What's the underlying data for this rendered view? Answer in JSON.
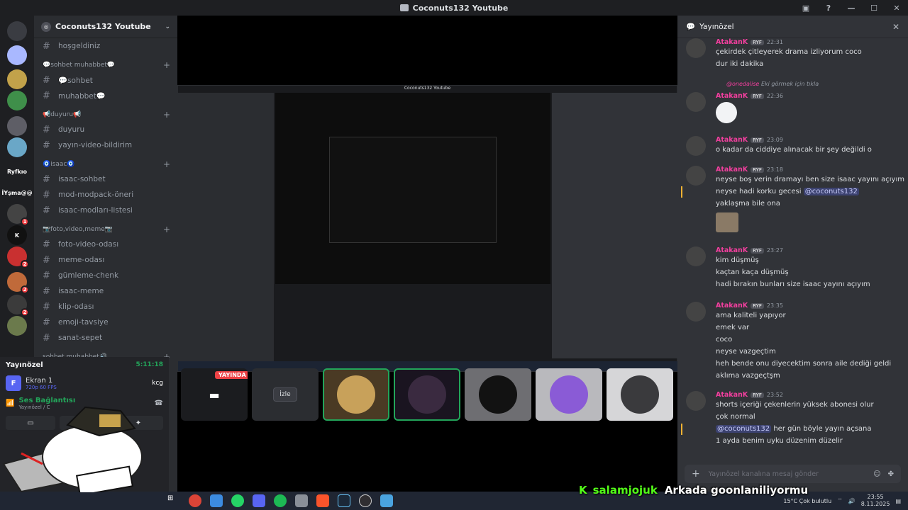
{
  "window": {
    "title": "Coconuts132 Youtube"
  },
  "rail": {
    "servers": [
      {
        "label": "",
        "color": "#3a3c42",
        "badge": ""
      },
      {
        "label": "",
        "color": "#a9b8ff",
        "badge": ""
      },
      {
        "label": "",
        "color": "#c2a24a",
        "badge": ""
      },
      {
        "label": "",
        "color": "#3f8f4a",
        "badge": ""
      },
      {
        "label": "",
        "color": "#5e5e66",
        "badge": ""
      },
      {
        "label": "",
        "color": "#6aa7c7",
        "badge": ""
      },
      {
        "label": "Ryfkıo",
        "color": "#1e1f22",
        "badge": ""
      },
      {
        "label": "İYşma@@",
        "color": "#1e1f22",
        "badge": ""
      },
      {
        "label": "",
        "color": "#444",
        "badge": "1"
      },
      {
        "label": "K",
        "color": "#111",
        "badge": ""
      },
      {
        "label": "",
        "color": "#c93030",
        "badge": "2"
      },
      {
        "label": "",
        "color": "#c06a3a",
        "badge": "2"
      },
      {
        "label": "",
        "color": "#3b3b3b",
        "badge": "2"
      },
      {
        "label": "",
        "color": "#6b7a4c",
        "badge": ""
      }
    ]
  },
  "sidebar": {
    "server_name": "Coconuts132 Youtube",
    "top_channel": "hoşgeldiniz",
    "categories": [
      {
        "name": "💬sohbet muhabbet💬",
        "channels": [
          "💬sohbet",
          "muhabbet💬"
        ]
      },
      {
        "name": "📢duyuru📢",
        "channels": [
          "duyuru",
          "yayın-video-bildirim"
        ]
      },
      {
        "name": "🧿isaac🧿",
        "channels": [
          "isaac-sohbet",
          "mod-modpack-öneri",
          "isaac-modları-listesi"
        ]
      },
      {
        "name": "📷foto,video,meme📷",
        "channels": [
          "foto-video-odası",
          "meme-odası",
          "gümleme-chenk",
          "isaac-meme",
          "klip-odası",
          "emoji-tavsiye",
          "sanat-sepet"
        ]
      },
      {
        "name": "sohbet muhabbet🔊",
        "channels": []
      }
    ]
  },
  "voice_panel": {
    "header": "Yayınözel",
    "time": "5:11:18",
    "stream_name": "Ekran 1",
    "stream_quality": "720p 60 FPS",
    "connection": "Ses Bağlantısı",
    "channel_path": "Yayınözel / C",
    "overlay_label": "kcg"
  },
  "stream": {
    "live_badge": "YAYINDA",
    "watch_label": "İzle",
    "nested_title": "Coconuts132 Youtube"
  },
  "chat": {
    "header": "Yayınözel",
    "input_placeholder": "Yayınözel kanalına mesaj gönder",
    "messages": [
      {
        "user": "AtakanK",
        "tag": "RYF",
        "time": "22:31",
        "lines": [
          "çekirdek çitleyerek drama izliyorum coco",
          "dur iki dakika"
        ]
      },
      {
        "reply_user": "@onedalise",
        "reply_text": "Eki görmek için tıkla",
        "user": "AtakanK",
        "tag": "RYF",
        "time": "22:36"
      },
      {
        "user": "AtakanK",
        "tag": "RYF",
        "time": "23:09",
        "lines": [
          "o kadar da ciddiye alınacak bir şey değildi o"
        ]
      },
      {
        "user": "AtakanK",
        "tag": "RYF",
        "time": "23:18",
        "lines": [
          "neyse boş verin dramayı ben size isaac yayını açıyım",
          "neyse hadi korku gecesi",
          "yaklaşma bile ona"
        ],
        "mention": "@coconuts132"
      },
      {
        "user": "AtakanK",
        "tag": "RYF",
        "time": "23:27",
        "lines": [
          "kim düşmüş",
          "kaçtan kaça düşmüş",
          "hadi bırakın bunları size isaac yayını açıyım"
        ]
      },
      {
        "user": "AtakanK",
        "tag": "RYF",
        "time": "23:35",
        "lines": [
          "ama kaliteli yapıyor",
          "emek var",
          "coco",
          "neyse vazgeçtim",
          "heh bende onu diyecektim sonra aile dediği geldi",
          "aklıma vazgeçtşm"
        ]
      },
      {
        "user": "AtakanK",
        "tag": "RYF",
        "time": "23:52",
        "lines": [
          "shorts içeriği çekenlerin yüksek abonesi olur",
          "çok normal",
          "her gün böyle yayın açsana",
          "1 ayda benim uyku düzenim düzelir"
        ],
        "mention": "@coconuts132"
      }
    ]
  },
  "taskbar": {
    "weather": "15°C  Çok bulutlu",
    "time": "23:55",
    "date": "8.11.2025"
  },
  "overlay": {
    "k_logo": "K",
    "username": "salamjojuk",
    "message": "Arkada goonlaniliyormu"
  },
  "colors": {
    "accent": "#5865f2",
    "username": "#f23f9e",
    "live": "#ed4245",
    "online": "#23a55a",
    "kick": "#53fc18"
  }
}
